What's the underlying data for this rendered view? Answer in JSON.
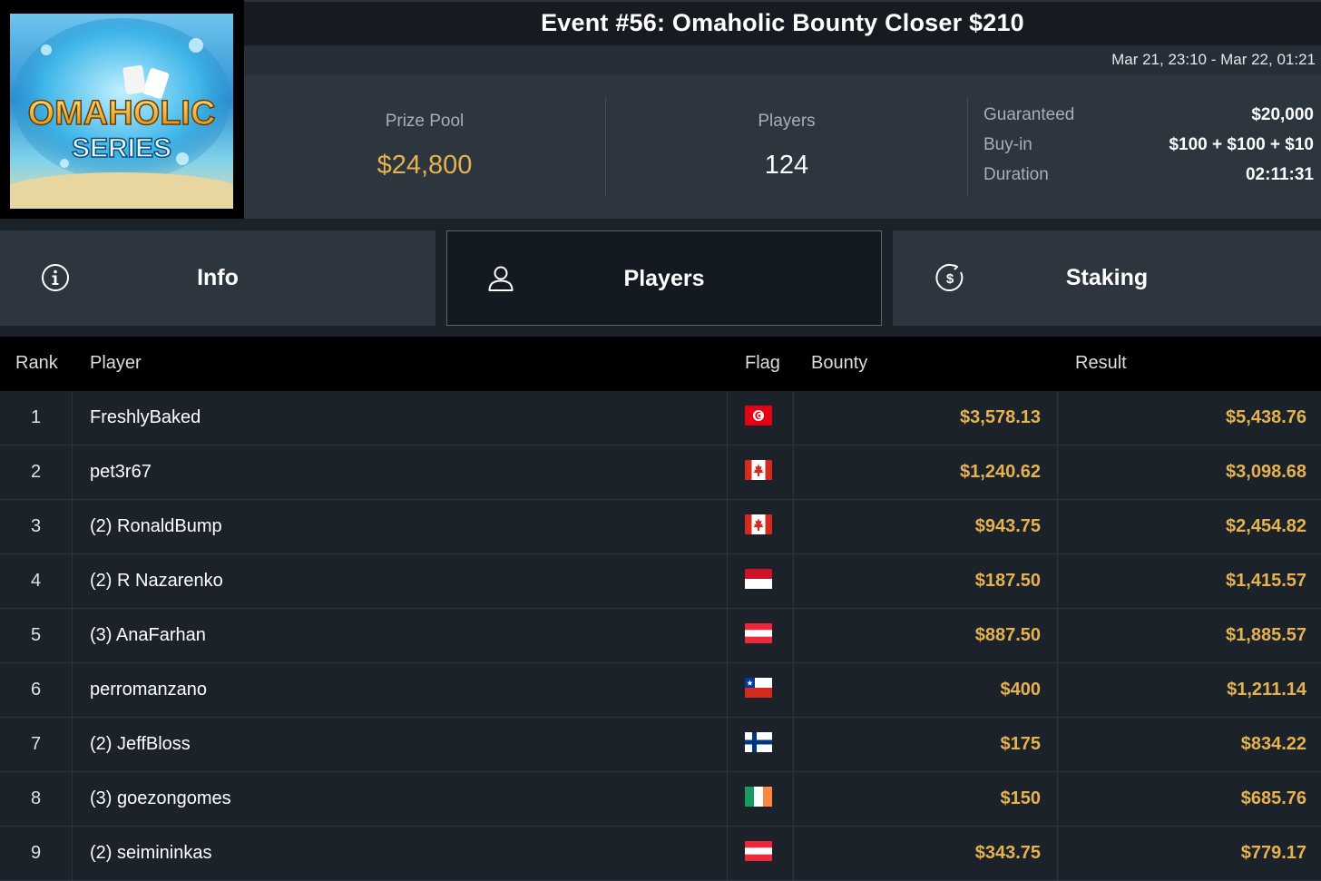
{
  "header": {
    "logo_text_line1": "OMAHOLIC",
    "logo_text_line2": "SERIES",
    "title": "Event #56: Omaholic Bounty Closer $210",
    "date_range": "Mar 21, 23:10 - Mar 22, 01:21"
  },
  "stats": {
    "prize_pool_label": "Prize Pool",
    "prize_pool_value": "$24,800",
    "players_label": "Players",
    "players_value": "124",
    "details": [
      {
        "label": "Guaranteed",
        "value": "$20,000"
      },
      {
        "label": "Buy-in",
        "value": "$100 + $100 + $10"
      },
      {
        "label": "Duration",
        "value": "02:11:31"
      }
    ]
  },
  "tabs": [
    {
      "label": "Info",
      "icon": "info-icon",
      "active": false
    },
    {
      "label": "Players",
      "icon": "user-icon",
      "active": true
    },
    {
      "label": "Staking",
      "icon": "dollar-icon",
      "active": false
    }
  ],
  "table": {
    "columns": {
      "rank": "Rank",
      "player": "Player",
      "flag": "Flag",
      "bounty": "Bounty",
      "result": "Result"
    },
    "rows": [
      {
        "rank": "1",
        "player": "FreshlyBaked",
        "flag": "tunisia-flag-icon",
        "bounty": "$3,578.13",
        "result": "$5,438.76"
      },
      {
        "rank": "2",
        "player": "pet3r67",
        "flag": "canada-flag-icon",
        "bounty": "$1,240.62",
        "result": "$3,098.68"
      },
      {
        "rank": "3",
        "player": "(2) RonaldBump",
        "flag": "canada-flag-icon",
        "bounty": "$943.75",
        "result": "$2,454.82"
      },
      {
        "rank": "4",
        "player": "(2) R Nazarenko",
        "flag": "monaco-flag-icon",
        "bounty": "$187.50",
        "result": "$1,415.57"
      },
      {
        "rank": "5",
        "player": "(3) AnaFarhan",
        "flag": "austria-flag-icon",
        "bounty": "$887.50",
        "result": "$1,885.57"
      },
      {
        "rank": "6",
        "player": "perromanzano",
        "flag": "chile-flag-icon",
        "bounty": "$400",
        "result": "$1,211.14"
      },
      {
        "rank": "7",
        "player": "(2) JeffBloss",
        "flag": "finland-flag-icon",
        "bounty": "$175",
        "result": "$834.22"
      },
      {
        "rank": "8",
        "player": "(3) goezongomes",
        "flag": "ireland-flag-icon",
        "bounty": "$150",
        "result": "$685.76"
      },
      {
        "rank": "9",
        "player": "(2) seimininkas",
        "flag": "austria-flag-icon",
        "bounty": "$343.75",
        "result": "$779.17"
      }
    ]
  },
  "colors": {
    "accent_gold": "#e6b24f",
    "panel": "#2d353e",
    "header_black": "#000000"
  }
}
